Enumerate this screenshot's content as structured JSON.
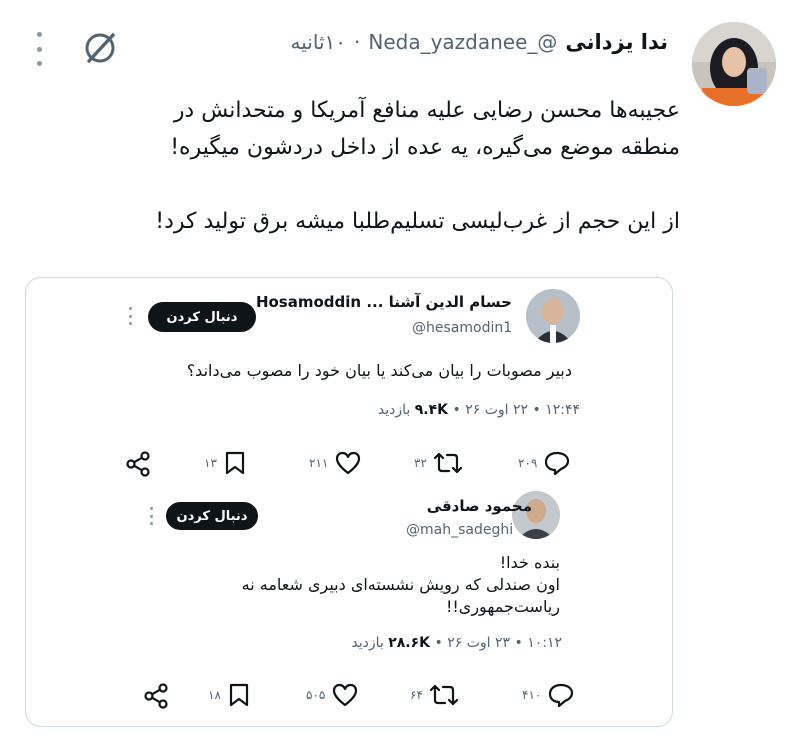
{
  "tweet": {
    "author_name": "ندا یزدانی",
    "author_handle": "@_Neda_yazdanee",
    "separator": "·",
    "time": "۱۰ثانیه",
    "body_lines": [
      "عجیبه‌ها محسن رضایی علیه منافع آمریکا و متحدانش در",
      "منطقه موضع می‌گیره، یه عده از داخل دردشون میگیره!",
      "از این حجم از غرب‌لیسی تسلیم‌طلبا میشه برق تولید کرد!"
    ]
  },
  "quote1": {
    "name": "حسام الدین آشنا ... Hosamoddin",
    "handle": "@hesamodin1",
    "follow_label": "دنبال کردن",
    "text": "دبیر مصوبات را بیان می‌کند یا بیان خود را مصوب می‌داند؟",
    "meta_time": "۱۲:۴۴ • ۲۲ اوت ۲۶ •",
    "meta_views": "۹.۴K",
    "meta_views_label": "بازدید",
    "actions": {
      "reply": "۲۰۹",
      "retweet": "۳۲",
      "like": "۲۱۱",
      "bookmark": "۱۳"
    }
  },
  "quote2": {
    "name": "محمود صادقی",
    "handle": "@mah_sadeghi",
    "follow_label": "دنبال کردن",
    "text_lines": [
      "بنده خدا!",
      "اون صندلی که رویش نشسته‌ای دبیری شعامه نه",
      "ریاست‌جمهوری!!"
    ],
    "meta_time": "۱۰:۱۲ • ۲۳ اوت ۲۶ •",
    "meta_views": "۲۸.۶K",
    "meta_views_label": "بازدید",
    "actions": {
      "reply": "۴۱۰",
      "retweet": "۶۴",
      "like": "۵۰۵",
      "bookmark": "۱۸"
    }
  },
  "colors": {
    "text": "#0f1419",
    "muted": "#536471",
    "border": "#cfd9de",
    "button": "#0f1419"
  },
  "icons": [
    "grok-icon",
    "more-icon",
    "reply-icon",
    "retweet-icon",
    "like-icon",
    "bookmark-icon",
    "share-icon"
  ]
}
